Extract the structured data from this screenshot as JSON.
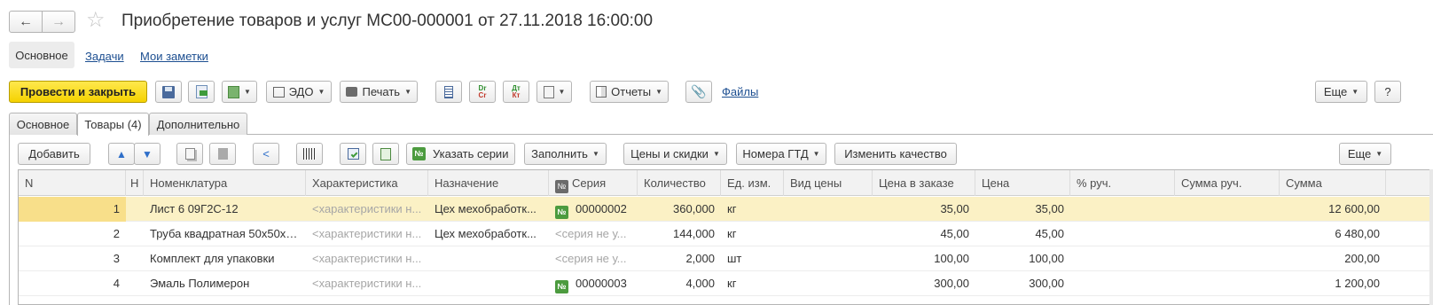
{
  "window": {
    "title": "Приобретение товаров и услуг МС00-000001 от 27.11.2018 16:00:00",
    "back_icon": "←",
    "forward_icon": "→",
    "star_icon": "☆"
  },
  "top_tabs": {
    "main": "Основное",
    "tasks": "Задачи",
    "notes": "Мои заметки"
  },
  "toolbar": {
    "post_close": "Провести и закрыть",
    "edo": "ЭДО",
    "print": "Печать",
    "reports": "Отчеты",
    "files": "Файлы",
    "more": "Еще",
    "help": "?",
    "dtkt_label_top": "Dr",
    "dtkt_label_bottom": "Cr",
    "dtkt2_label_top": "Дт",
    "dtkt2_label_bottom": "Кт"
  },
  "doc_tabs": {
    "main": "Основное",
    "goods": "Товары (4)",
    "extra": "Дополнительно"
  },
  "table_toolbar": {
    "add": "Добавить",
    "series_badge": "№",
    "set_series": "Указать серии",
    "fill": "Заполнить",
    "prices": "Цены и скидки",
    "gtd": "Номера ГТД",
    "change_quality": "Изменить качество",
    "more": "Еще"
  },
  "table": {
    "headers": {
      "n": "N",
      "flag": "Н",
      "nomenclature": "Номенклатура",
      "characteristic": "Характеристика",
      "purpose": "Назначение",
      "series_badge": "№",
      "series": "Серия",
      "quantity": "Количество",
      "unit": "Ед. изм.",
      "price_type": "Вид цены",
      "order_price": "Цена в заказе",
      "price": "Цена",
      "manual_pct": "% руч.",
      "manual_sum": "Сумма руч.",
      "sum": "Сумма"
    },
    "rows": [
      {
        "n": "1",
        "nomenclature": "Лист 6 09Г2С-12",
        "characteristic": "<характеристики н...",
        "purpose": "Цех мехобработк...",
        "series_badge": "№",
        "series": "00000002",
        "quantity": "360,000",
        "unit": "кг",
        "order_price": "35,00",
        "price": "35,00",
        "sum": "12 600,00"
      },
      {
        "n": "2",
        "nomenclature": "Труба квадратная 50x50x4...",
        "characteristic": "<характеристики н...",
        "purpose": "Цех мехобработк...",
        "series": "<серия не у...",
        "quantity": "144,000",
        "unit": "кг",
        "order_price": "45,00",
        "price": "45,00",
        "sum": "6 480,00"
      },
      {
        "n": "3",
        "nomenclature": "Комплект для упаковки",
        "characteristic": "<характеристики н...",
        "purpose": "",
        "series": "<серия не у...",
        "quantity": "2,000",
        "unit": "шт",
        "order_price": "100,00",
        "price": "100,00",
        "sum": "200,00"
      },
      {
        "n": "4",
        "nomenclature": "Эмаль Полимерон",
        "characteristic": "<характеристики н...",
        "purpose": "",
        "series_badge": "№",
        "series": "00000003",
        "quantity": "4,000",
        "unit": "кг",
        "order_price": "300,00",
        "price": "300,00",
        "sum": "1 200,00"
      }
    ]
  },
  "colors": {
    "primary_button": "#f5d200",
    "selected_row": "#fbf1c5",
    "link": "#1d4f91",
    "series_badge": "#4c9b3f"
  }
}
